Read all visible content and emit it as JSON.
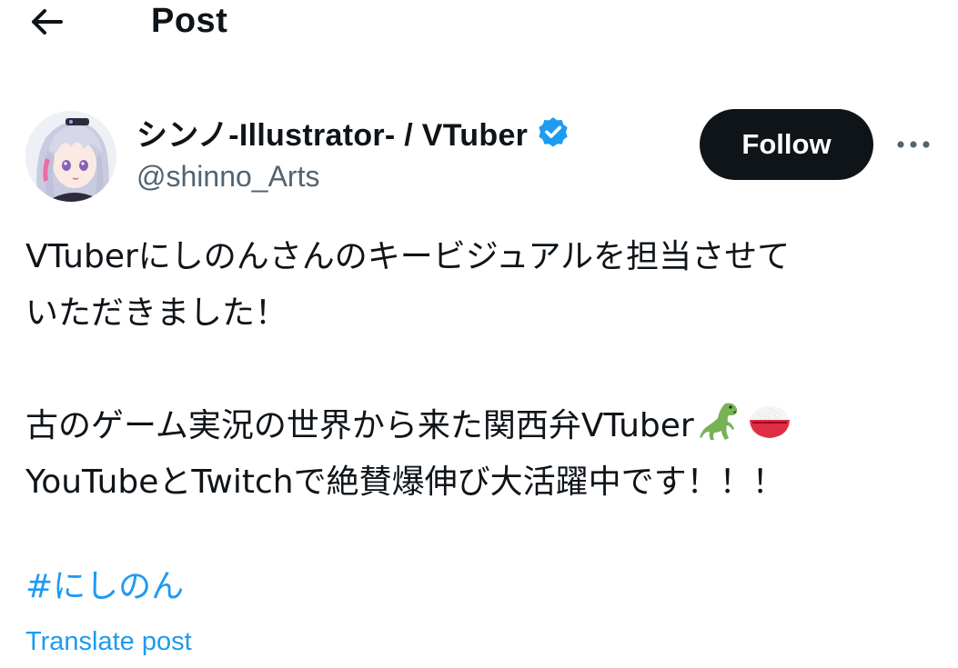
{
  "header": {
    "back_icon": "arrow-left-icon",
    "title": "Post"
  },
  "author": {
    "display_name": "シンノ-Illustrator- / VTuber",
    "verified_icon": "verified-badge-icon",
    "handle": "@shinno_Arts",
    "avatar_icon": "anime-avatar"
  },
  "actions": {
    "follow_label": "Follow",
    "more_icon": "more-horizontal-icon"
  },
  "post": {
    "line1": "VTuberにしのんさんのキービジュアルを担当させて",
    "line2": "いただきました！",
    "line3": "古のゲーム実況の世界から来た関西弁VTuber",
    "line4": "YouTubeとTwitchで絶賛爆伸び大活躍中です！！！",
    "emojis": [
      "t-rex-emoji",
      "rice-bowl-emoji"
    ],
    "hashtag": "#にしのん",
    "translate_label": "Translate post"
  },
  "colors": {
    "text": "#0f1419",
    "secondary": "#536471",
    "link": "#1d9bf0",
    "verified": "#1d9bf0",
    "button_bg": "#0f1419"
  }
}
